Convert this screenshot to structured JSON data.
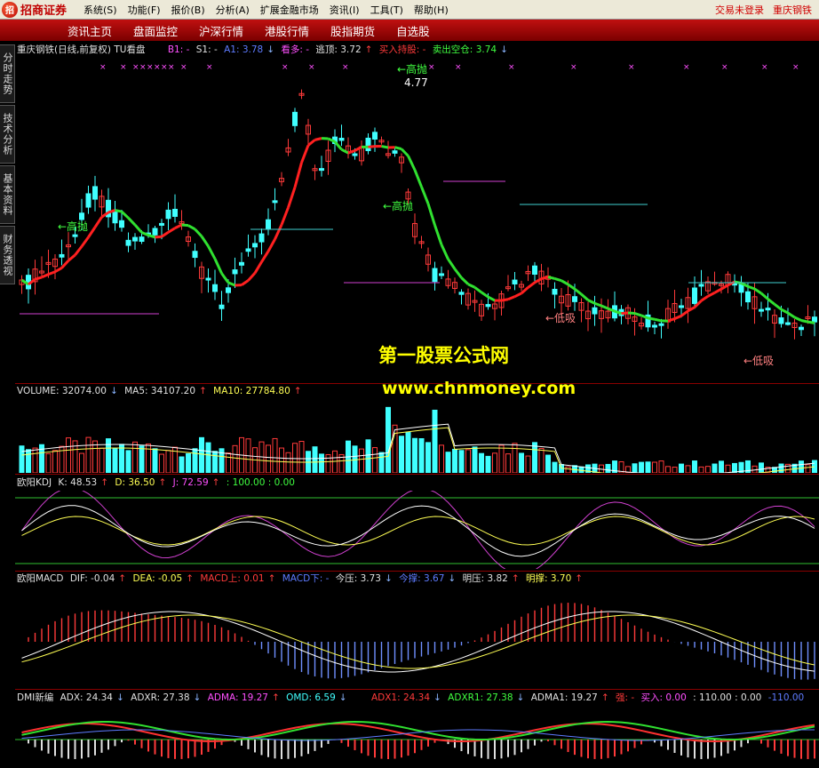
{
  "menubar": {
    "logo_mark": "招",
    "logo_text": "招商证券",
    "items": [
      "系统(S)",
      "功能(F)",
      "报价(B)",
      "分析(A)",
      "扩展金融市场",
      "资讯(I)",
      "工具(T)",
      "帮助(H)"
    ],
    "status_login": "交易未登录",
    "stock_name": "重庆钢铁"
  },
  "tabs": [
    "资讯主页",
    "盘面监控",
    "沪深行情",
    "港股行情",
    "股指期货",
    "自选股"
  ],
  "sidetabs": [
    "分时走势",
    "技术分析",
    "基本资料",
    "财务透视"
  ],
  "main_panel": {
    "title": "重庆钢铁(日线,前复权) TU看盘",
    "b1": "B1: -",
    "s1": "S1: -",
    "a1": "A1: 3.78",
    "kan_duo": "看多: -",
    "tao_ding": "逃顶: 3.72",
    "buy_hold": "买入持股: -",
    "sell_empty": "卖出空仓: 3.74",
    "annotations": {
      "high_sell": "高抛",
      "low_buy": "低吸",
      "peak_price": "4.77"
    }
  },
  "watermark": {
    "line1": "第一股票公式网",
    "line2": "www.chnmoney.com"
  },
  "volume_panel": {
    "volume": "VOLUME: 32074.00",
    "ma5": "MA5: 34107.20",
    "ma10": "MA10: 27784.80"
  },
  "kdj_panel": {
    "name": "欧阳KDJ",
    "k": "K: 48.53",
    "d": "D: 36.50",
    "j": "J: 72.59",
    "levels": ": 100.00 : 0.00"
  },
  "macd_panel": {
    "name": "欧阳MACD",
    "dif": "DIF: -0.04",
    "dea": "DEA: -0.05",
    "macd_up": "MACD上: 0.01",
    "macd_down": "MACD下: -",
    "jin_ya": "今压: 3.73",
    "jin_cheng": "今撑: 3.67",
    "ming_ya": "明压: 3.82",
    "ming_cheng": "明撑: 3.70"
  },
  "dmi_panel": {
    "name": "DMI新编",
    "adx": "ADX: 24.34",
    "adxr": "ADXR: 27.38",
    "adma": "ADMA: 19.27",
    "omd": "OMD: 6.59",
    "adx1": "ADX1: 24.34",
    "adxr1": "ADXR1: 27.38",
    "adma1": "ADMA1: 19.27",
    "strong": "强: -",
    "buy": "买入: 0.00",
    "levels": ": 110.00 : 0.00",
    "minus": "-110.00"
  },
  "colors": {
    "up": "#ff3a3a",
    "down": "#40ffff",
    "ma_up": "#ff2020",
    "ma_down": "#30e030",
    "accent": "#c01010"
  }
}
